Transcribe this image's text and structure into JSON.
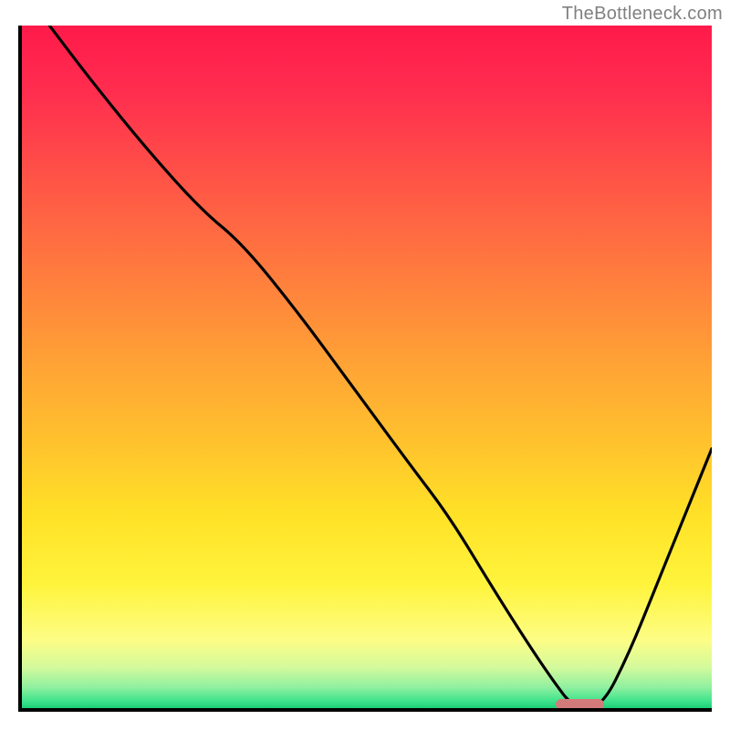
{
  "watermark": "TheBottleneck.com",
  "chart_data": {
    "type": "line",
    "title": "",
    "xlabel": "",
    "ylabel": "",
    "xlim": [
      0,
      100
    ],
    "ylim": [
      0,
      100
    ],
    "grid": false,
    "series": [
      {
        "name": "bottleneck-curve",
        "x": [
          4,
          10,
          18,
          26,
          32,
          40,
          48,
          56,
          62,
          68,
          73,
          77,
          80,
          84,
          88,
          92,
          96,
          100
        ],
        "values": [
          100,
          92,
          82,
          73,
          68,
          58,
          47,
          36,
          28,
          18,
          10,
          4,
          0,
          0,
          8,
          18,
          28,
          38
        ]
      }
    ],
    "optimal_marker": {
      "x_start": 77,
      "x_end": 84,
      "y": 0
    },
    "gradient_stops": [
      {
        "pct": 0,
        "color": "#ff1a4a"
      },
      {
        "pct": 50,
        "color": "#ffa435"
      },
      {
        "pct": 85,
        "color": "#fff43d"
      },
      {
        "pct": 100,
        "color": "#1ccf76"
      }
    ]
  }
}
